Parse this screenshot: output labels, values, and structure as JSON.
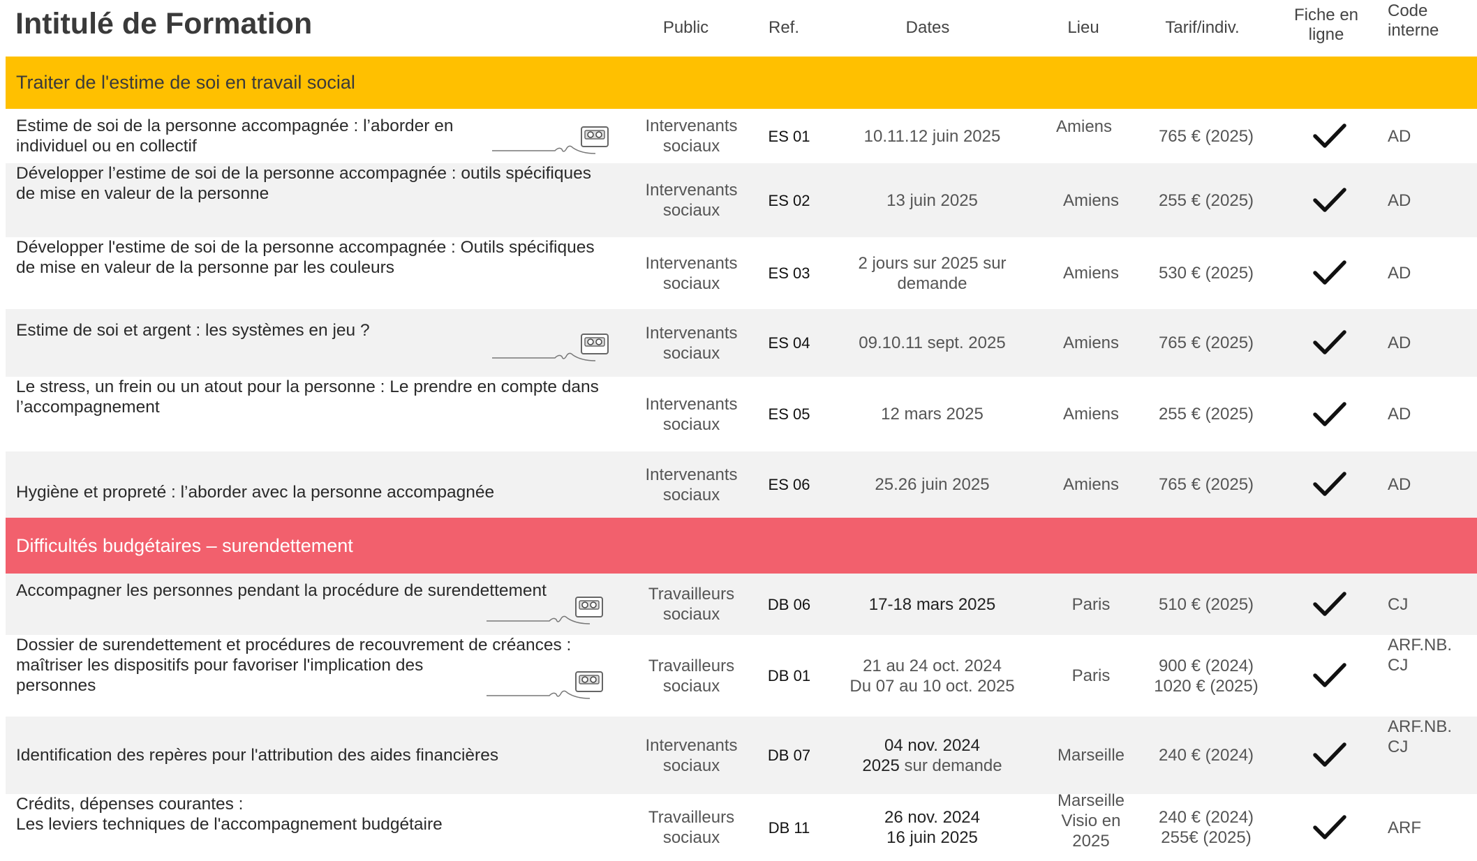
{
  "header": {
    "title": "Intitulé de Formation",
    "columns": {
      "public": "Public",
      "ref": "Ref.",
      "dates": "Dates",
      "lieu": "Lieu",
      "tarif": "Tarif/indiv.",
      "fiche_l1": "Fiche en",
      "fiche_l2": "ligne",
      "code_l1": "Code",
      "code_l2": "interne"
    }
  },
  "colors": {
    "section1": "#ffc000",
    "section2": "#f2606d",
    "row_alt": "#f2f2f2"
  },
  "sections": [
    {
      "title": "Traiter de l'estime de soi en travail social",
      "rows": [
        {
          "title_l1": "Estime de soi de la personne accompagnée : l’aborder en",
          "title_l2": "individuel ou en collectif",
          "public_l1": "Intervenants",
          "public_l2": "sociaux",
          "ref": "ES 01",
          "dates_l1": "10.11.12 juin 2025",
          "dates_l2": "",
          "lieu": "Amiens",
          "tarif_l1": "765 € (2025)",
          "tarif_l2": "",
          "code_l1": "AD",
          "code_l2": "",
          "icon": "cassette-tape-icon"
        },
        {
          "title_l1": "Développer l’estime de soi de la personne accompagnée : outils spécifiques",
          "title_l2": "de mise en valeur de la personne",
          "public_l1": "Intervenants",
          "public_l2": "sociaux",
          "ref": "ES 02",
          "dates_l1": "13 juin 2025",
          "dates_l2": "",
          "lieu": "Amiens",
          "tarif_l1": "255 € (2025)",
          "tarif_l2": "",
          "code_l1": "AD",
          "code_l2": ""
        },
        {
          "title_l1": "Développer l'estime de soi de la personne accompagnée : Outils spécifiques",
          "title_l2": "de mise en valeur de la personne par les couleurs",
          "public_l1": "Intervenants",
          "public_l2": "sociaux",
          "ref": "ES 03",
          "dates_l1": "2 jours sur 2025 sur",
          "dates_l2": "demande",
          "lieu": "Amiens",
          "tarif_l1": "530 € (2025)",
          "tarif_l2": "",
          "code_l1": "AD",
          "code_l2": ""
        },
        {
          "title_l1": "Estime de soi et argent : les systèmes en jeu ?",
          "title_l2": "",
          "public_l1": "Intervenants",
          "public_l2": "sociaux",
          "ref": "ES 04",
          "dates_l1": "09.10.11 sept. 2025",
          "dates_l2": "",
          "lieu": "Amiens",
          "tarif_l1": "765 € (2025)",
          "tarif_l2": "",
          "code_l1": "AD",
          "code_l2": "",
          "icon": "cassette-tape-icon"
        },
        {
          "title_l1": "Le stress, un frein ou un atout pour la personne : Le prendre en compte dans",
          "title_l2": "l’accompagnement",
          "public_l1": "Intervenants",
          "public_l2": "sociaux",
          "ref": "ES 05",
          "dates_l1": "12 mars 2025",
          "dates_l2": "",
          "lieu": "Amiens",
          "tarif_l1": "255 € (2025)",
          "tarif_l2": "",
          "code_l1": "AD",
          "code_l2": ""
        },
        {
          "title_l1": "Hygiène et propreté : l’aborder avec la personne accompagnée",
          "title_l2": "",
          "public_l1": "Intervenants",
          "public_l2": "sociaux",
          "ref": "ES 06",
          "dates_l1": "25.26 juin 2025",
          "dates_l2": "",
          "lieu": "Amiens",
          "tarif_l1": "765 € (2025)",
          "tarif_l2": "",
          "code_l1": "AD",
          "code_l2": ""
        }
      ]
    },
    {
      "title": "Difficultés budgétaires – surendettement",
      "rows": [
        {
          "title_l1": "Accompagner les personnes pendant la procédure de surendettement",
          "title_l2": "",
          "public_l1": "Travailleurs",
          "public_l2": "sociaux",
          "ref": "DB 06",
          "dates_l1": "17-18 mars 2025",
          "dates_l2": "",
          "lieu": "Paris",
          "tarif_l1": "510 € (2025)",
          "tarif_l2": "",
          "code_l1": "CJ",
          "code_l2": "",
          "icon": "cassette-tape-icon"
        },
        {
          "title_l1": "Dossier de surendettement et procédures de recouvrement de créances :",
          "title_l2": "maîtriser les dispositifs pour favoriser l'implication des",
          "title_l3": "personnes",
          "public_l1": "Travailleurs",
          "public_l2": "sociaux",
          "ref": "DB 01",
          "dates_l1": "21 au 24 oct. 2024",
          "dates_l2": "Du 07 au 10 oct. 2025",
          "lieu": "Paris",
          "tarif_l1": "900 € (2024)",
          "tarif_l2": "1020 € (2025)",
          "code_l1": "ARF.NB.",
          "code_l2": "CJ",
          "icon": "cassette-tape-icon"
        },
        {
          "title_l1": "Identification des repères pour l'attribution des aides financières",
          "title_l2": "",
          "public_l1": "Intervenants",
          "public_l2": "sociaux",
          "ref": "DB 07",
          "dates_l1": "04 nov. 2024",
          "dates_l2a": "2025",
          "dates_l2b": " sur demande",
          "lieu": "Marseille",
          "tarif_l1": "240 € (2024)",
          "tarif_l2": "",
          "code_l1": "ARF.NB.",
          "code_l2": "CJ"
        },
        {
          "title_l1": "Crédits, dépenses courantes :",
          "title_l2": "Les leviers techniques de l'accompagnement budgétaire",
          "public_l1": "Travailleurs",
          "public_l2": "sociaux",
          "ref": "DB 11",
          "dates_l1": "26 nov. 2024",
          "dates_l2": "16 juin 2025",
          "lieu_l1": "Marseille",
          "lieu_l2": "Visio en",
          "lieu_l3": "2025",
          "tarif_l1": "240 € (2024)",
          "tarif_l2": "255€ (2025)",
          "code_l1": "ARF",
          "code_l2": ""
        }
      ]
    }
  ]
}
